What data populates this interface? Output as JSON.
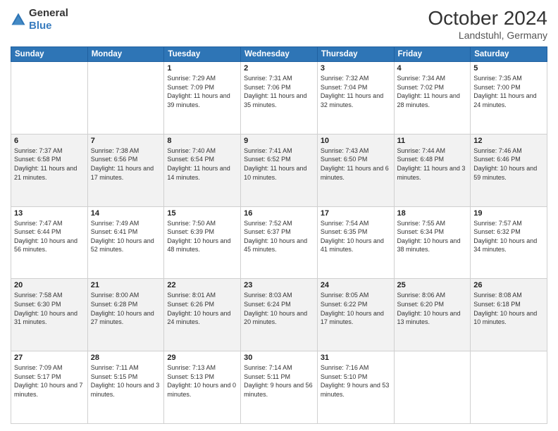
{
  "header": {
    "logo_general": "General",
    "logo_blue": "Blue",
    "month_year": "October 2024",
    "location": "Landstuhl, Germany"
  },
  "days_of_week": [
    "Sunday",
    "Monday",
    "Tuesday",
    "Wednesday",
    "Thursday",
    "Friday",
    "Saturday"
  ],
  "weeks": [
    [
      {
        "day": "",
        "info": ""
      },
      {
        "day": "",
        "info": ""
      },
      {
        "day": "1",
        "info": "Sunrise: 7:29 AM\nSunset: 7:09 PM\nDaylight: 11 hours and 39 minutes."
      },
      {
        "day": "2",
        "info": "Sunrise: 7:31 AM\nSunset: 7:06 PM\nDaylight: 11 hours and 35 minutes."
      },
      {
        "day": "3",
        "info": "Sunrise: 7:32 AM\nSunset: 7:04 PM\nDaylight: 11 hours and 32 minutes."
      },
      {
        "day": "4",
        "info": "Sunrise: 7:34 AM\nSunset: 7:02 PM\nDaylight: 11 hours and 28 minutes."
      },
      {
        "day": "5",
        "info": "Sunrise: 7:35 AM\nSunset: 7:00 PM\nDaylight: 11 hours and 24 minutes."
      }
    ],
    [
      {
        "day": "6",
        "info": "Sunrise: 7:37 AM\nSunset: 6:58 PM\nDaylight: 11 hours and 21 minutes."
      },
      {
        "day": "7",
        "info": "Sunrise: 7:38 AM\nSunset: 6:56 PM\nDaylight: 11 hours and 17 minutes."
      },
      {
        "day": "8",
        "info": "Sunrise: 7:40 AM\nSunset: 6:54 PM\nDaylight: 11 hours and 14 minutes."
      },
      {
        "day": "9",
        "info": "Sunrise: 7:41 AM\nSunset: 6:52 PM\nDaylight: 11 hours and 10 minutes."
      },
      {
        "day": "10",
        "info": "Sunrise: 7:43 AM\nSunset: 6:50 PM\nDaylight: 11 hours and 6 minutes."
      },
      {
        "day": "11",
        "info": "Sunrise: 7:44 AM\nSunset: 6:48 PM\nDaylight: 11 hours and 3 minutes."
      },
      {
        "day": "12",
        "info": "Sunrise: 7:46 AM\nSunset: 6:46 PM\nDaylight: 10 hours and 59 minutes."
      }
    ],
    [
      {
        "day": "13",
        "info": "Sunrise: 7:47 AM\nSunset: 6:44 PM\nDaylight: 10 hours and 56 minutes."
      },
      {
        "day": "14",
        "info": "Sunrise: 7:49 AM\nSunset: 6:41 PM\nDaylight: 10 hours and 52 minutes."
      },
      {
        "day": "15",
        "info": "Sunrise: 7:50 AM\nSunset: 6:39 PM\nDaylight: 10 hours and 48 minutes."
      },
      {
        "day": "16",
        "info": "Sunrise: 7:52 AM\nSunset: 6:37 PM\nDaylight: 10 hours and 45 minutes."
      },
      {
        "day": "17",
        "info": "Sunrise: 7:54 AM\nSunset: 6:35 PM\nDaylight: 10 hours and 41 minutes."
      },
      {
        "day": "18",
        "info": "Sunrise: 7:55 AM\nSunset: 6:34 PM\nDaylight: 10 hours and 38 minutes."
      },
      {
        "day": "19",
        "info": "Sunrise: 7:57 AM\nSunset: 6:32 PM\nDaylight: 10 hours and 34 minutes."
      }
    ],
    [
      {
        "day": "20",
        "info": "Sunrise: 7:58 AM\nSunset: 6:30 PM\nDaylight: 10 hours and 31 minutes."
      },
      {
        "day": "21",
        "info": "Sunrise: 8:00 AM\nSunset: 6:28 PM\nDaylight: 10 hours and 27 minutes."
      },
      {
        "day": "22",
        "info": "Sunrise: 8:01 AM\nSunset: 6:26 PM\nDaylight: 10 hours and 24 minutes."
      },
      {
        "day": "23",
        "info": "Sunrise: 8:03 AM\nSunset: 6:24 PM\nDaylight: 10 hours and 20 minutes."
      },
      {
        "day": "24",
        "info": "Sunrise: 8:05 AM\nSunset: 6:22 PM\nDaylight: 10 hours and 17 minutes."
      },
      {
        "day": "25",
        "info": "Sunrise: 8:06 AM\nSunset: 6:20 PM\nDaylight: 10 hours and 13 minutes."
      },
      {
        "day": "26",
        "info": "Sunrise: 8:08 AM\nSunset: 6:18 PM\nDaylight: 10 hours and 10 minutes."
      }
    ],
    [
      {
        "day": "27",
        "info": "Sunrise: 7:09 AM\nSunset: 5:17 PM\nDaylight: 10 hours and 7 minutes."
      },
      {
        "day": "28",
        "info": "Sunrise: 7:11 AM\nSunset: 5:15 PM\nDaylight: 10 hours and 3 minutes."
      },
      {
        "day": "29",
        "info": "Sunrise: 7:13 AM\nSunset: 5:13 PM\nDaylight: 10 hours and 0 minutes."
      },
      {
        "day": "30",
        "info": "Sunrise: 7:14 AM\nSunset: 5:11 PM\nDaylight: 9 hours and 56 minutes."
      },
      {
        "day": "31",
        "info": "Sunrise: 7:16 AM\nSunset: 5:10 PM\nDaylight: 9 hours and 53 minutes."
      },
      {
        "day": "",
        "info": ""
      },
      {
        "day": "",
        "info": ""
      }
    ]
  ]
}
